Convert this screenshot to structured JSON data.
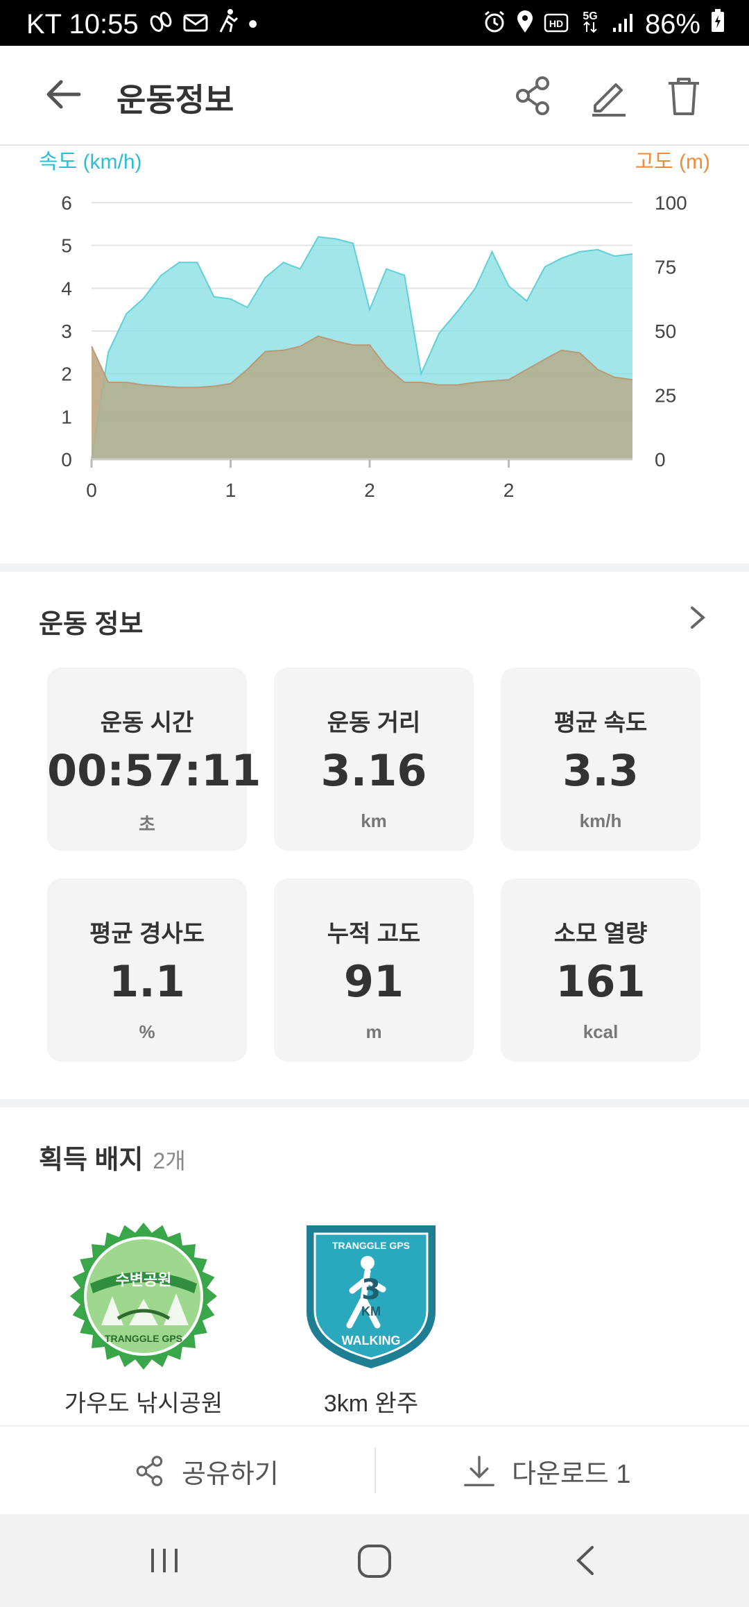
{
  "status_bar": {
    "carrier_time": "KT 10:55",
    "dot": "•",
    "battery": "86%"
  },
  "header": {
    "title": "운동정보"
  },
  "chart_data": {
    "type": "area",
    "left_axis_label": "속도 (km/h)",
    "right_axis_label": "고도 (m)",
    "x_ticks": [
      "0",
      "1",
      "2",
      "2"
    ],
    "y_left_ticks": [
      "0",
      "1",
      "2",
      "3",
      "4",
      "5",
      "6"
    ],
    "y_right_ticks": [
      "0",
      "25",
      "50",
      "75",
      "100"
    ],
    "ylim_left": [
      0,
      6
    ],
    "ylim_right": [
      0,
      100
    ],
    "xlim": [
      0,
      3.89
    ],
    "colors": {
      "speed": "#84dde3",
      "altitude": "#b7ad8a",
      "altitude_edge": "#f5a57a"
    },
    "series": [
      {
        "axis": "left",
        "x": [
          0,
          0.12,
          0.25,
          0.37,
          0.5,
          0.63,
          0.76,
          0.88,
          1.0,
          1.12,
          1.25,
          1.38,
          1.5,
          1.63,
          1.76,
          1.88,
          2.0,
          2.12,
          2.25,
          2.37,
          2.5,
          2.63,
          2.76,
          2.88,
          3.0,
          3.13,
          3.26,
          3.38,
          3.51,
          3.64,
          3.76,
          3.89
        ],
        "values": [
          0,
          2.5,
          3.4,
          3.75,
          4.3,
          4.6,
          4.6,
          3.8,
          3.75,
          3.55,
          4.25,
          4.6,
          4.45,
          5.2,
          5.15,
          5.05,
          3.5,
          4.45,
          4.3,
          2.0,
          2.95,
          3.45,
          4.0,
          4.85,
          4.05,
          3.7,
          4.5,
          4.7,
          4.85,
          4.9,
          4.75,
          4.8
        ]
      },
      {
        "axis": "right",
        "x": [
          0,
          0.12,
          0.25,
          0.37,
          0.5,
          0.63,
          0.76,
          0.88,
          1.0,
          1.12,
          1.25,
          1.38,
          1.5,
          1.63,
          1.76,
          1.88,
          2.0,
          2.12,
          2.25,
          2.37,
          2.5,
          2.63,
          2.76,
          2.88,
          3.0,
          3.13,
          3.26,
          3.38,
          3.51,
          3.64,
          3.76,
          3.89
        ],
        "values": [
          44,
          30,
          30,
          29,
          28.5,
          28,
          28,
          28.5,
          29.5,
          35,
          42,
          42.5,
          44,
          48,
          46,
          44.5,
          44.5,
          36,
          30,
          30,
          29,
          29,
          30,
          30.5,
          31,
          35,
          39,
          42.5,
          41.5,
          35,
          32,
          31
        ]
      }
    ]
  },
  "workout": {
    "title": "운동 정보",
    "stats": [
      {
        "label": "운동 시간",
        "value": "00:57:11",
        "unit": "초"
      },
      {
        "label": "운동 거리",
        "value": "3.16",
        "unit": "km"
      },
      {
        "label": "평균 속도",
        "value": "3.3",
        "unit": "km/h"
      },
      {
        "label": "평균 경사도",
        "value": "1.1",
        "unit": "%"
      },
      {
        "label": "누적 고도",
        "value": "91",
        "unit": "m"
      },
      {
        "label": "소모 열량",
        "value": "161",
        "unit": "kcal"
      }
    ]
  },
  "badges": {
    "title": "획득 배지",
    "count": "2개",
    "items": [
      {
        "name": "가우도 낚시공원",
        "emblem_top": "수변공원",
        "emblem_bottom": "TRANGGLE GPS",
        "colors": [
          "#3aa64a",
          "#9ed88f"
        ]
      },
      {
        "name": "3km 완주",
        "emblem_top": "TRANGGLE GPS",
        "emblem_number": "3",
        "emblem_unit": "KM",
        "emblem_bottom": "WALKING",
        "colors": [
          "#1e7f94",
          "#2aa8bd"
        ]
      }
    ]
  },
  "bottom_actions": {
    "share_label": "공유하기",
    "download_label": "다운로드",
    "download_count": "1"
  }
}
